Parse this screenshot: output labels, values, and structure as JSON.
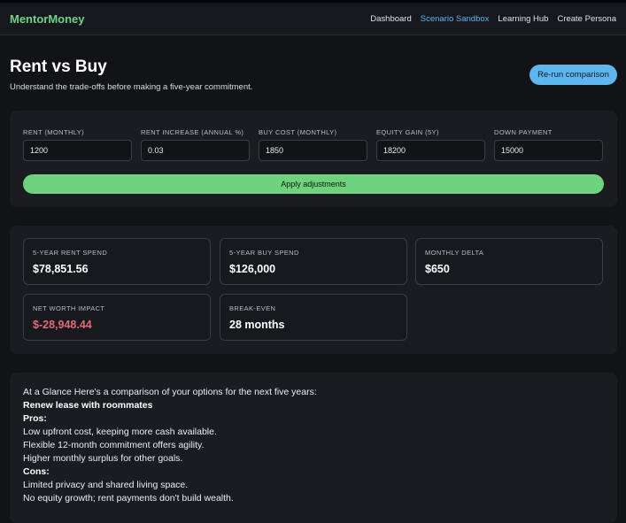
{
  "header": {
    "brand": "MentorMoney",
    "nav": [
      "Dashboard",
      "Scenario Sandbox",
      "Learning Hub",
      "Create Persona"
    ]
  },
  "page": {
    "title": "Rent vs Buy",
    "subtitle": "Understand the trade-offs before making a five-year commitment.",
    "rerun_label": "Re-run comparison"
  },
  "inputs": {
    "fields": [
      {
        "label": "Rent (monthly)",
        "value": "1200"
      },
      {
        "label": "Rent increase (annual %)",
        "value": "0.03"
      },
      {
        "label": "Buy cost (monthly)",
        "value": "1850"
      },
      {
        "label": "Equity gain (5y)",
        "value": "18200"
      },
      {
        "label": "Down payment",
        "value": "15000"
      }
    ],
    "apply_label": "Apply adjustments"
  },
  "stats": [
    {
      "label": "5-year rent spend",
      "value": "$78,851.56"
    },
    {
      "label": "5-year buy spend",
      "value": "$126,000"
    },
    {
      "label": "Monthly delta",
      "value": "$650"
    },
    {
      "label": "Net worth impact",
      "value": "$-28,948.44"
    },
    {
      "label": "Break-even",
      "value": "28 months"
    }
  ],
  "glance": {
    "intro": "At a Glance Here's a comparison of your options for the next five years:",
    "option_title": "Renew lease with roommates",
    "pros_label": "Pros:",
    "pros": [
      "Low upfront cost, keeping more cash available.",
      "Flexible 12-month commitment offers agility.",
      "Higher monthly surplus for other goals."
    ],
    "cons_label": "Cons:",
    "cons": [
      "Limited privacy and shared living space.",
      "No equity growth; rent payments don't build wealth."
    ]
  },
  "colors": {
    "brand": "#6fd28a",
    "accent_blue": "#5fb6ee",
    "apply_green": "#6fd27f",
    "negative": "#e06b78"
  }
}
